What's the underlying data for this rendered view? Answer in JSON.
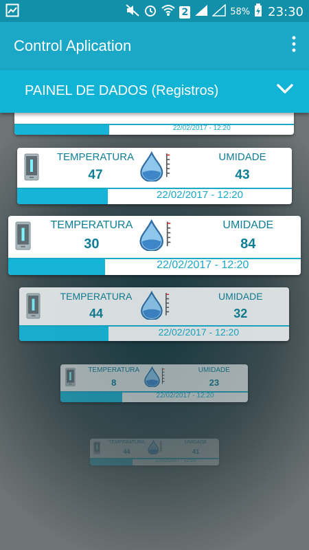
{
  "status_bar": {
    "sim": "2",
    "battery": "58%",
    "time": "23:30"
  },
  "app_bar": {
    "title": "Control Aplication"
  },
  "panel": {
    "title": "PAINEL DE DADOS (Registros)"
  },
  "cards": [
    {
      "temp_label": "",
      "temperatura": "",
      "hum_label": "",
      "umidade": "",
      "date": "22/02/2017 - 12:20",
      "progress": 0.34
    },
    {
      "temp_label": "TEMPERATURA",
      "temperatura": "47",
      "hum_label": "UMIDADE",
      "umidade": "43",
      "date": "22/02/2017 - 12:20",
      "progress": 0.33
    },
    {
      "temp_label": "TEMPERATURA",
      "temperatura": "30",
      "hum_label": "UMIDADE",
      "umidade": "84",
      "date": "22/02/2017 - 12:20",
      "progress": 0.33
    },
    {
      "temp_label": "TEMPERATURA",
      "temperatura": "44",
      "hum_label": "UMIDADE",
      "umidade": "32",
      "date": "22/02/2017 - 12:20",
      "progress": 0.33
    },
    {
      "temp_label": "TEMPERATURA",
      "temperatura": "8",
      "hum_label": "UMIDADE",
      "umidade": "23",
      "date": "22/02/2017 - 12:20",
      "progress": 0.33
    },
    {
      "temp_label": "TEMPERATURA",
      "temperatura": "44",
      "hum_label": "UMIDADE",
      "umidade": "41",
      "date": "22/02/2017 - 12:20",
      "progress": 0.33
    }
  ],
  "colors": {
    "status_bar": "#1390a9",
    "app_bar": "#1aa8c6",
    "panel_bar": "#12b4d6",
    "accent_text": "#0e7e95",
    "progress": "#16b5d8"
  }
}
